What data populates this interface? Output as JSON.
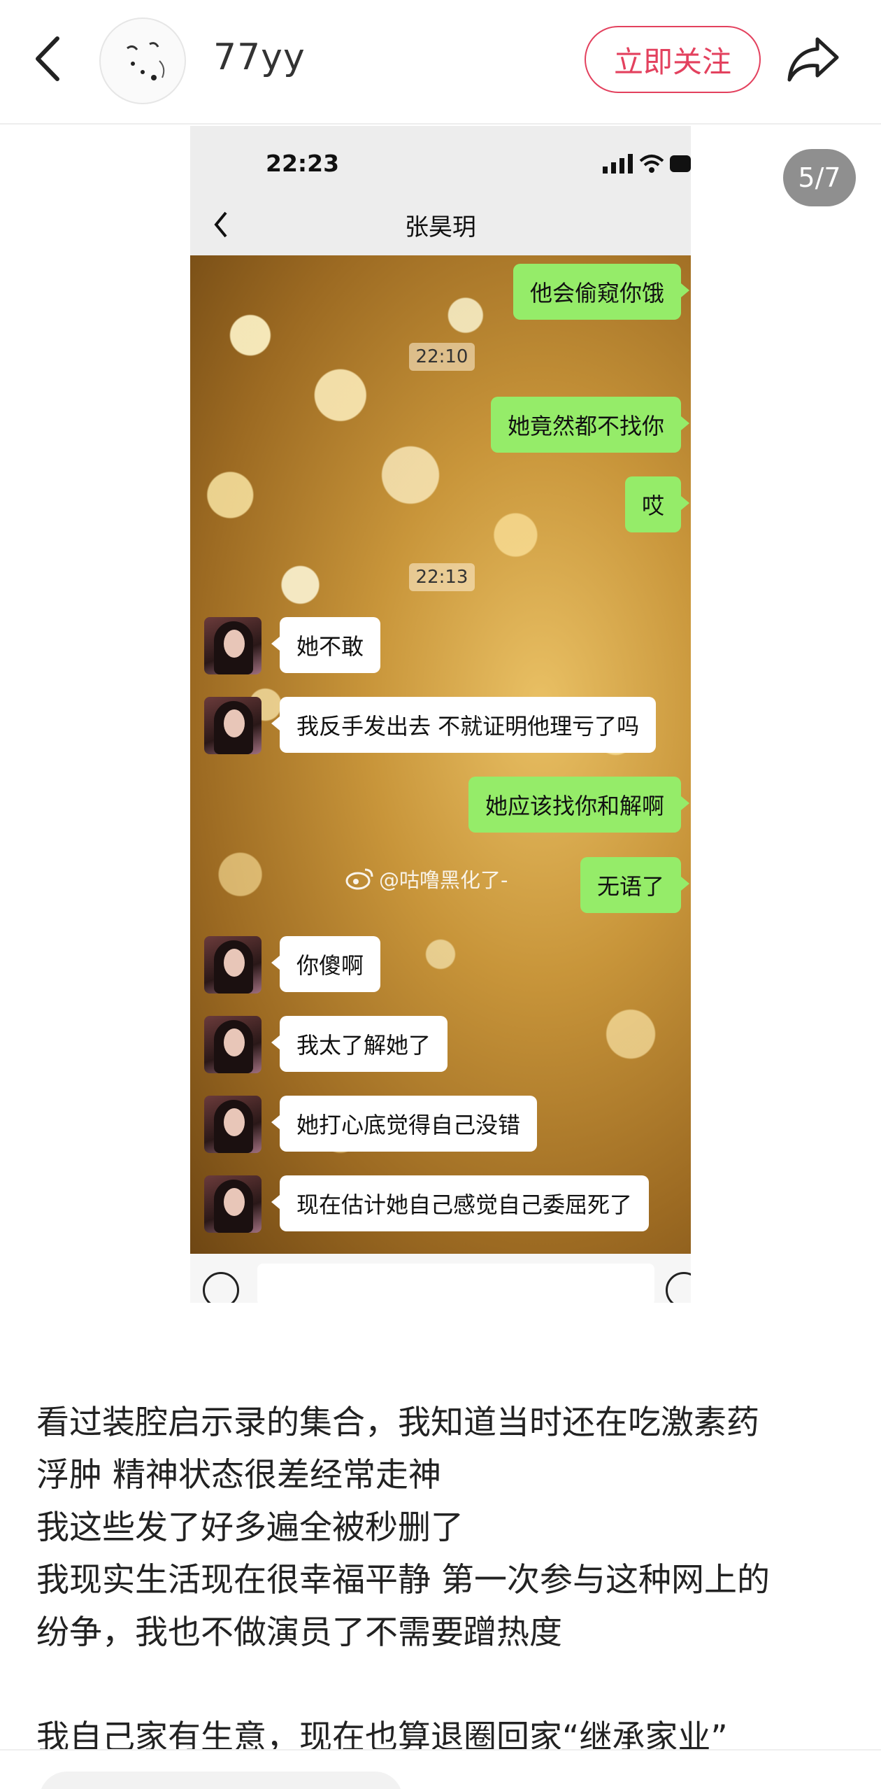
{
  "header": {
    "username": "77yy",
    "follow_label": "立即关注",
    "icons": {
      "back": "back-arrow-icon",
      "share": "share-arrow-icon"
    }
  },
  "carousel": {
    "counter": "5/7"
  },
  "screenshot": {
    "status_time": "22:23",
    "chat_title": "张昊玥",
    "watermark": "@咕噜黑化了-",
    "messages": [
      {
        "side": "right",
        "text": "他会偷窥你饿"
      },
      {
        "kind": "time",
        "text": "22:10"
      },
      {
        "side": "right",
        "text": "她竟然都不找你"
      },
      {
        "side": "right",
        "text": "哎"
      },
      {
        "kind": "time",
        "text": "22:13"
      },
      {
        "side": "left",
        "text": "她不敢"
      },
      {
        "side": "left",
        "text": "我反手发出去 不就证明他理亏了吗"
      },
      {
        "side": "right",
        "text": "她应该找你和解啊"
      },
      {
        "side": "right",
        "text": "无语了"
      },
      {
        "side": "left",
        "text": "你傻啊"
      },
      {
        "side": "left",
        "text": "我太了解她了"
      },
      {
        "side": "left",
        "text": "她打心底觉得自己没错"
      },
      {
        "side": "left",
        "text": "现在估计她自己感觉自己委屈死了"
      }
    ]
  },
  "post": {
    "lines": [
      "看过装腔启示录的集合，我知道当时还在吃激素药",
      "浮肿 精神状态很差经常走神",
      "我这些发了好多遍全被秒删了",
      "我现实生活现在很幸福平静 第一次参与这种网上的",
      "纷争，我也不做演员了不需要蹭热度",
      "",
      "我自己家有生意，现在也算退圈回家“继承家业”"
    ]
  }
}
